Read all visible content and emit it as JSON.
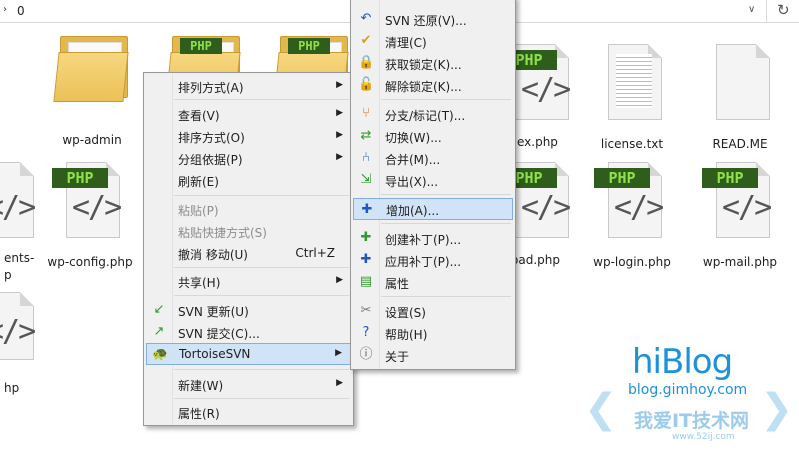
{
  "address_bar": {
    "path": "0"
  },
  "files": [
    {
      "label": "wp-admin",
      "kind": "folder"
    },
    {
      "label": "",
      "kind": "php-folder"
    },
    {
      "label": "",
      "kind": "php-folder"
    },
    {
      "label": "ex.php",
      "kind": "php"
    },
    {
      "label": "license.txt",
      "kind": "txt"
    },
    {
      "label": "READ.ME",
      "kind": "doc"
    },
    {
      "label": "ents-",
      "label2": "p",
      "kind": "doc-partial"
    },
    {
      "label": "wp-config.php",
      "kind": "php"
    },
    {
      "label": "oad.php",
      "kind": "php"
    },
    {
      "label": "wp-login.php",
      "kind": "php"
    },
    {
      "label": "wp-mail.php",
      "kind": "php"
    },
    {
      "label": "hp",
      "kind": "doc-partial"
    }
  ],
  "php_badge": "PHP",
  "context_menu": {
    "items": [
      {
        "label": "排列方式(A)",
        "submenu": true
      },
      {
        "label": "查看(V)",
        "submenu": true
      },
      {
        "label": "排序方式(O)",
        "submenu": true
      },
      {
        "label": "分组依据(P)",
        "submenu": true
      },
      {
        "label": "刷新(E)"
      },
      {
        "label": "粘贴(P)",
        "disabled": true
      },
      {
        "label": "粘贴快捷方式(S)",
        "disabled": true
      },
      {
        "label": "撤消 移动(U)",
        "shortcut": "Ctrl+Z"
      },
      {
        "label": "共享(H)",
        "submenu": true
      },
      {
        "label": "SVN 更新(U)",
        "icon": "svn-update-icon"
      },
      {
        "label": "SVN 提交(C)...",
        "icon": "svn-commit-icon"
      },
      {
        "label": "TortoiseSVN",
        "submenu": true,
        "icon": "tortoisesvn-icon",
        "highlighted": true
      },
      {
        "label": "新建(W)",
        "submenu": true
      },
      {
        "label": "属性(R)"
      }
    ]
  },
  "svn_submenu": {
    "items": [
      {
        "label": "SVN 还原(V)...",
        "icon": "revert-icon"
      },
      {
        "label": "清理(C)",
        "icon": "cleanup-icon"
      },
      {
        "label": "获取锁定(K)...",
        "icon": "lock-icon"
      },
      {
        "label": "解除锁定(K)...",
        "icon": "unlock-icon"
      },
      {
        "label": "分支/标记(T)...",
        "icon": "branch-icon"
      },
      {
        "label": "切换(W)...",
        "icon": "switch-icon"
      },
      {
        "label": "合并(M)...",
        "icon": "merge-icon"
      },
      {
        "label": "导出(X)...",
        "icon": "export-icon"
      },
      {
        "label": "增加(A)...",
        "icon": "add-icon",
        "highlighted": true
      },
      {
        "label": "创建补丁(P)...",
        "icon": "create-patch-icon"
      },
      {
        "label": "应用补丁(P)...",
        "icon": "apply-patch-icon"
      },
      {
        "label": "属性",
        "icon": "properties-icon"
      },
      {
        "label": "设置(S)",
        "icon": "settings-icon"
      },
      {
        "label": "帮助(H)",
        "icon": "help-icon"
      },
      {
        "label": "关于",
        "icon": "about-icon"
      }
    ]
  },
  "watermark": {
    "title": "hiBlog",
    "url": "blog.gimhoy.com",
    "slogan": "我爱IT技术网",
    "small": "www.52ij.com"
  },
  "colors": {
    "menu_bg": "#f0f0f0",
    "highlight": "#d1e3f7",
    "highlight_border": "#84aee0",
    "php_badge_bg": "#2f5d1b",
    "php_badge_text": "#8fe04a",
    "watermark": "#1d92d8"
  }
}
